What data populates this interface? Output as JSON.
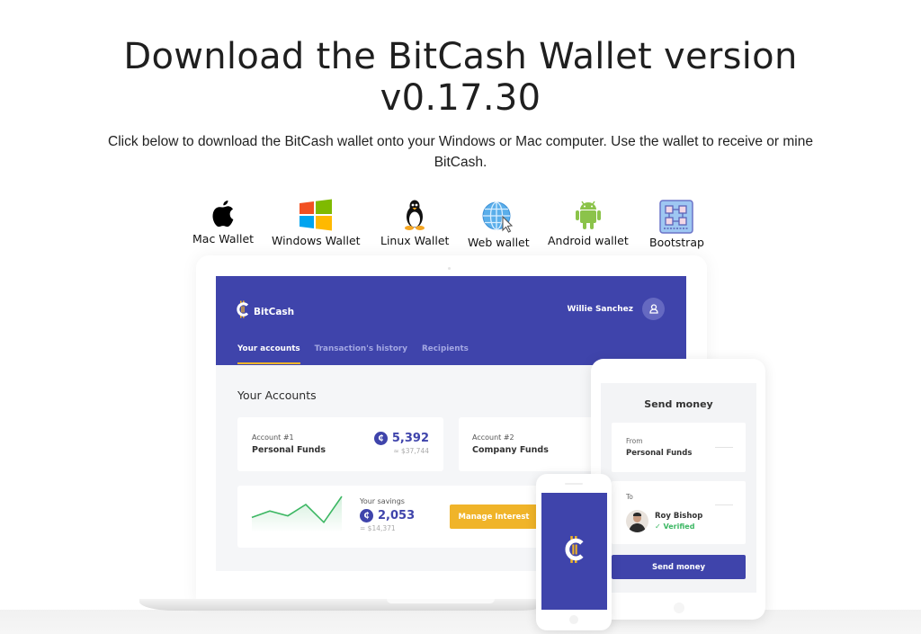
{
  "page": {
    "headline_line1": "Download the BitCash Wallet version",
    "headline_line2": "v0.17.30",
    "subtext_line1": "Click below to download the BitCash wallet onto your Windows or Mac computer. Use the wallet to receive or mine",
    "subtext_line2": "BitCash."
  },
  "downloads": [
    {
      "label": "Mac Wallet",
      "icon": "apple-icon"
    },
    {
      "label": "Windows Wallet",
      "icon": "windows-icon"
    },
    {
      "label": "Linux Wallet",
      "icon": "linux-penguin-icon"
    },
    {
      "label": "Web wallet",
      "icon": "globe-cursor-icon"
    },
    {
      "label": "Android wallet",
      "icon": "android-icon"
    },
    {
      "label": "Bootstrap",
      "icon": "bootstrap-blocks-icon"
    }
  ],
  "app": {
    "brand": "BitCash",
    "user_name": "Willie Sanchez",
    "tabs": [
      {
        "label": "Your accounts",
        "active": true
      },
      {
        "label": "Transaction's history",
        "active": false
      },
      {
        "label": "Recipients",
        "active": false
      }
    ],
    "section_title": "Your Accounts",
    "accounts": [
      {
        "number": "Account #1",
        "name": "Personal Funds",
        "amount": "5,392",
        "fiat": "≈ $37,744"
      },
      {
        "number": "Account #2",
        "name": "Company Funds"
      }
    ],
    "savings": {
      "label": "Your savings",
      "amount": "2,053",
      "fiat": "= $14,371",
      "button": "Manage Interest",
      "sparkline": [
        0.35,
        0.55,
        0.4,
        0.75,
        0.2,
        1.0
      ]
    },
    "coin_glyph": "₵"
  },
  "send": {
    "title": "Send money",
    "from_label": "From",
    "from_value": "Personal Funds",
    "to_label": "To",
    "recipient_name": "Roy Bishop",
    "recipient_status": "✓ Verified",
    "button": "Send money"
  },
  "colors": {
    "brand_blue": "#3f44ab",
    "accent_yellow": "#f0b429",
    "verified_green": "#3cb763"
  }
}
